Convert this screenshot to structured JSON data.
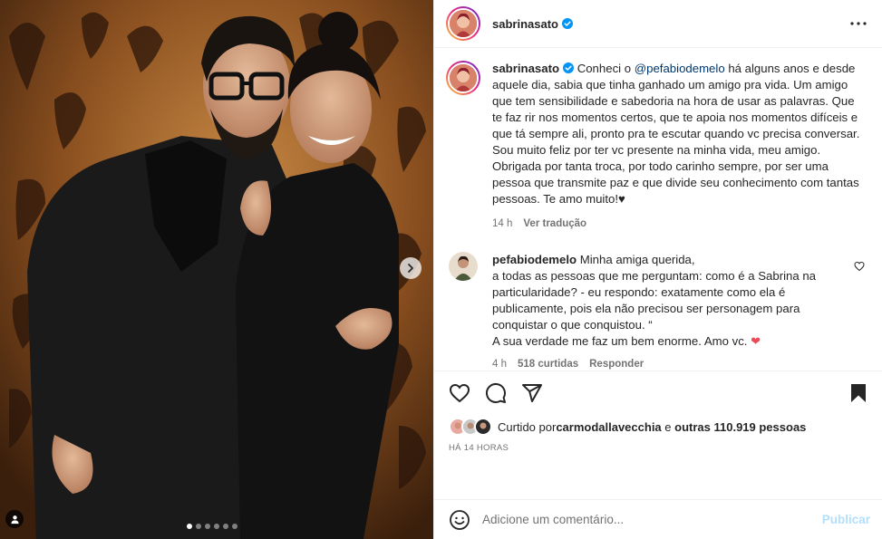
{
  "post": {
    "username": "sabrinasato",
    "image_alt": "Photo of Sabrina Sato and Fabio de Melo",
    "carousel": {
      "current": 1,
      "total": 6
    }
  },
  "caption": {
    "username": "sabrinasato",
    "text_before_mention": "Conheci o ",
    "mention": "@pefabiodemelo",
    "text_after_mention": " há alguns anos e desde aquele dia, sabia que tinha ganhado um amigo pra vida. Um amigo que tem sensibilidade e sabedoria na hora de usar as palavras. Que te faz rir nos momentos certos, que te apoia nos momentos difíceis e que tá sempre ali, pronto pra te escutar quando vc precisa conversar.",
    "paragraph2": "Sou muito feliz por ter vc presente na minha vida, meu amigo. Obrigada por tanta troca, por todo carinho sempre, por ser uma pessoa que transmite paz e que divide seu conhecimento com tantas pessoas. Te amo muito!♥",
    "time": "14 h",
    "translate": "Ver tradução"
  },
  "comment": {
    "username": "pefabiodemelo",
    "line1": "Minha amiga querida,",
    "line2": "a todas as pessoas que me perguntam: como é a Sabrina na particularidade? - eu respondo: exatamente como ela é publicamente, pois ela não precisou ser personagem para conquistar o que conquistou. “",
    "line3": "A sua verdade me faz um bem enorme. Amo vc. ",
    "heart_emoji": "❤️",
    "time": "4 h",
    "likes": "518 curtidas",
    "reply": "Responder"
  },
  "likes": {
    "prefix": "Curtido por ",
    "user": "carmodallavecchia",
    "middle": " e ",
    "others": "outras 110.919 pessoas"
  },
  "timestamp": "HÁ 14 HORAS",
  "add_comment": {
    "placeholder": "Adicione um comentário...",
    "publish": "Publicar"
  },
  "colors": {
    "verified": "#0095f6",
    "mention": "#00376b",
    "publish_disabled": "#b2dffc",
    "heart": "#ed4956"
  },
  "icons": [
    "verified-icon",
    "more-options-icon",
    "heart-icon",
    "comment-icon",
    "share-icon",
    "bookmark-icon",
    "emoji-icon",
    "chevron-right-icon",
    "user-tag-icon"
  ]
}
